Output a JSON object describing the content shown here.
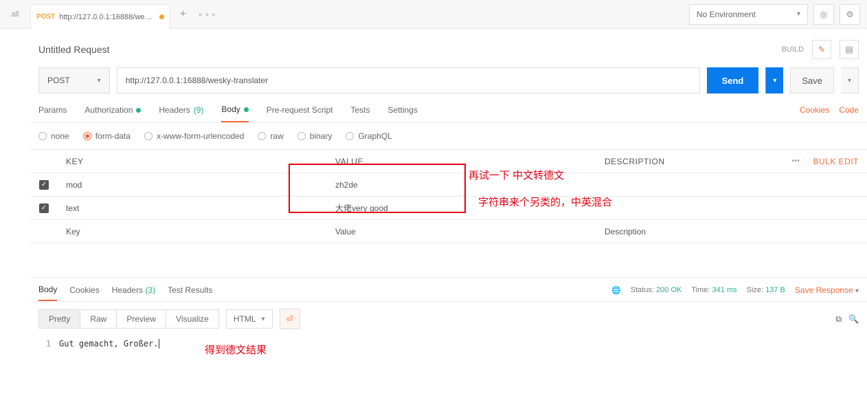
{
  "sidebar": {
    "label": "all"
  },
  "tab": {
    "method": "POST",
    "url_short": "http://127.0.0.1:16888/wesky-t..."
  },
  "env": {
    "label": "No Environment"
  },
  "request": {
    "title": "Untitled Request",
    "build": "BUILD",
    "method": "POST",
    "url": "http://127.0.0.1:16888/wesky-translater",
    "send": "Send",
    "save": "Save"
  },
  "req_tabs": {
    "params": "Params",
    "authorization": "Authorization",
    "headers": "Headers",
    "headers_count": "(9)",
    "body": "Body",
    "prerequest": "Pre-request Script",
    "tests": "Tests",
    "settings": "Settings",
    "cookies": "Cookies",
    "code": "Code"
  },
  "body_types": {
    "none": "none",
    "formdata": "form-data",
    "xwww": "x-www-form-urlencoded",
    "raw": "raw",
    "binary": "binary",
    "graphql": "GraphQL"
  },
  "kv": {
    "header_key": "KEY",
    "header_value": "VALUE",
    "header_desc": "DESCRIPTION",
    "bulk": "Bulk Edit",
    "rows": [
      {
        "key": "mod",
        "value": "zh2de"
      },
      {
        "key": "text",
        "value": "大佬very good"
      }
    ],
    "ph_key": "Key",
    "ph_value": "Value",
    "ph_desc": "Description"
  },
  "annotations": {
    "a1": "再试一下 中文转德文",
    "a2": "字符串来个另类的，中英混合",
    "a3": "得到德文结果"
  },
  "resp_tabs": {
    "body": "Body",
    "cookies": "Cookies",
    "headers": "Headers",
    "headers_count": "(3)",
    "tests": "Test Results"
  },
  "status": {
    "label": "Status:",
    "value": "200 OK",
    "time_label": "Time:",
    "time_value": "341 ms",
    "size_label": "Size:",
    "size_value": "137 B",
    "save": "Save Response"
  },
  "views": {
    "pretty": "Pretty",
    "raw": "Raw",
    "preview": "Preview",
    "visualize": "Visualize",
    "format": "HTML"
  },
  "response_body": {
    "line": "1",
    "text": "Gut gemacht, Großer."
  }
}
